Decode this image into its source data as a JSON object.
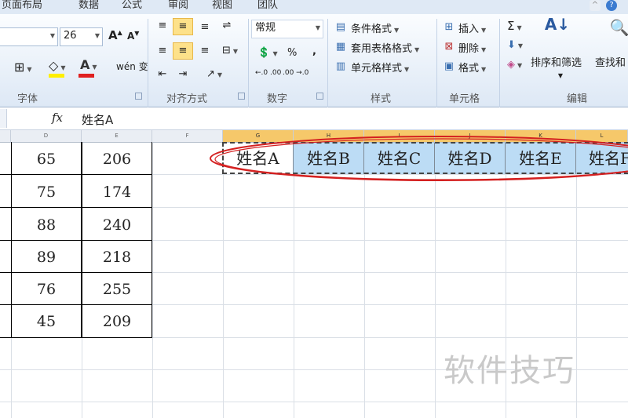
{
  "ribbon_tabs": [
    "页面布局",
    "数据",
    "公式",
    "审阅",
    "视图",
    "团队"
  ],
  "font": {
    "size": "26",
    "group_label": "字体",
    "grow": "A",
    "shrink": "A",
    "font_color_letter": "A",
    "phonetic": "wén 变"
  },
  "alignment": {
    "group_label": "对齐方式"
  },
  "number": {
    "format": "常规",
    "group_label": "数字",
    "percent": "%",
    "comma": ",",
    "inc_decimal": "←.0 .00",
    "dec_decimal": ".00 →.0"
  },
  "styles": {
    "group_label": "样式",
    "items": [
      "条件格式",
      "套用表格格式",
      "单元格样式"
    ]
  },
  "cells": {
    "group_label": "单元格",
    "items": [
      "插入",
      "删除",
      "格式"
    ]
  },
  "editing": {
    "group_label": "编辑",
    "sum_symbol": "Σ",
    "sort_filter": "排序和筛选",
    "find_select": "查找和"
  },
  "formula_bar": {
    "fx": "fx",
    "content": "姓名A"
  },
  "columns": [
    "D",
    "E",
    "F",
    "G",
    "H",
    "I",
    "J",
    "K",
    "L"
  ],
  "table": {
    "rows": [
      [
        "65",
        "206"
      ],
      [
        "75",
        "174"
      ],
      [
        "88",
        "240"
      ],
      [
        "89",
        "218"
      ],
      [
        "76",
        "255"
      ],
      [
        "45",
        "209"
      ]
    ]
  },
  "header_row": [
    "姓名A",
    "姓名B",
    "姓名C",
    "姓名D",
    "姓名E",
    "姓名F"
  ],
  "watermark": "软件技巧",
  "colors": {
    "selection": "#bcdcf5",
    "highlight_ellipse": "#d42020",
    "selected_col_header": "#f6c86a"
  }
}
